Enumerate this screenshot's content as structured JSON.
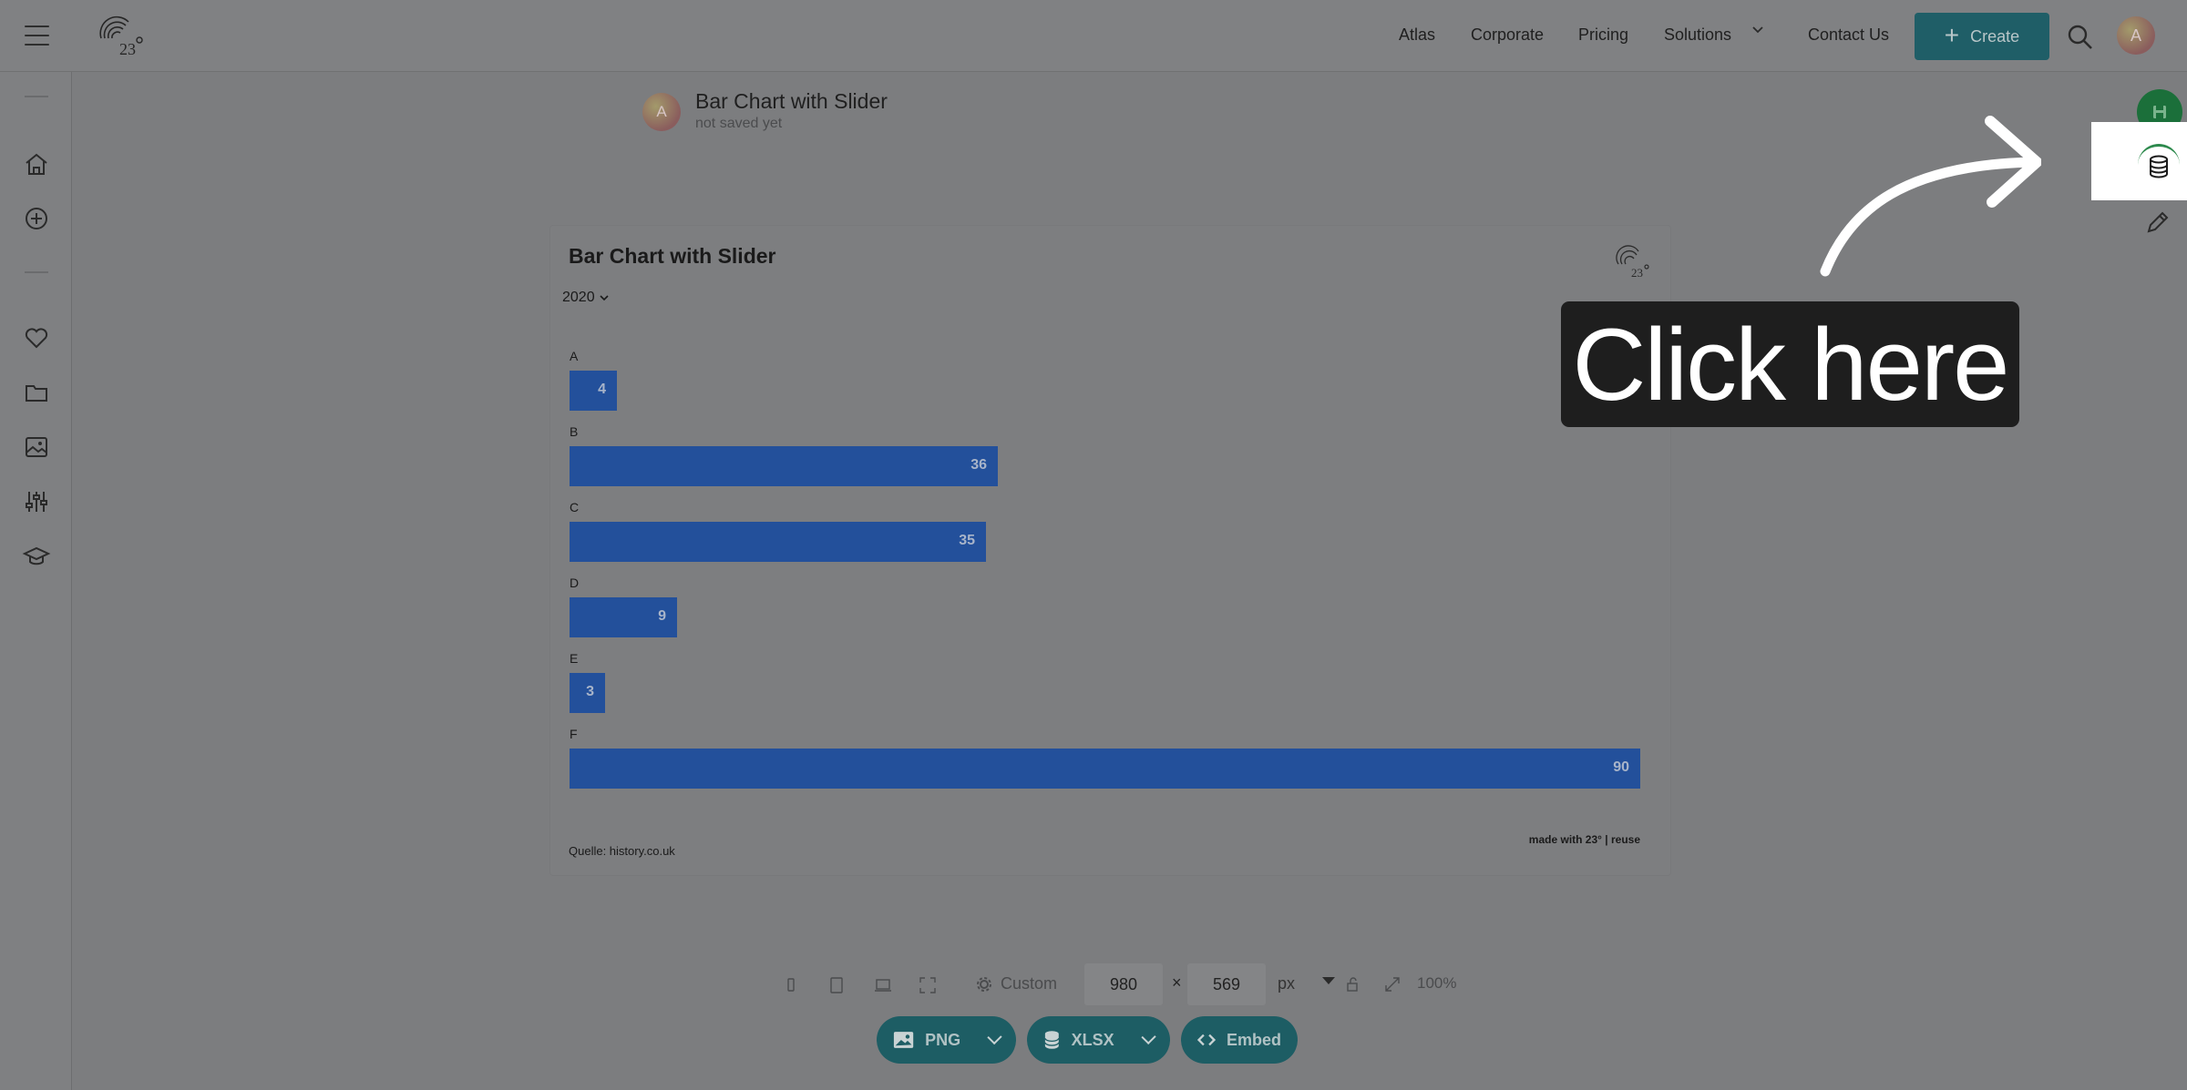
{
  "header": {
    "nav": [
      "Atlas",
      "Corporate",
      "Pricing",
      "Solutions",
      "Contact Us"
    ],
    "create_label": "Create",
    "avatar_initial": "A"
  },
  "logo_text": "23°",
  "document": {
    "avatar_initial": "A",
    "title": "Bar Chart with Slider",
    "status": "not saved yet"
  },
  "chart": {
    "title": "Bar Chart with Slider",
    "slider_value": "2020",
    "source": "Quelle: history.co.uk",
    "credit": "made with 23° | reuse"
  },
  "chart_data": {
    "type": "bar",
    "orientation": "horizontal",
    "title": "Bar Chart with Slider",
    "categories": [
      "A",
      "B",
      "C",
      "D",
      "E",
      "F"
    ],
    "values": [
      4,
      36,
      35,
      9,
      3,
      90
    ],
    "bar_color": "#23509b",
    "xlim": [
      0,
      90
    ],
    "grid": false
  },
  "toolbar": {
    "preset_label": "Custom",
    "width_value": "980",
    "height_value": "569",
    "times": "×",
    "unit": "px",
    "zoom": "100%",
    "exports": [
      "PNG",
      "XLSX",
      "Embed"
    ]
  },
  "overlay": {
    "callout_text": "Click here"
  },
  "colors": {
    "accent": "#1f5e67",
    "save": "#1b6f3a",
    "bar": "#23509b"
  }
}
